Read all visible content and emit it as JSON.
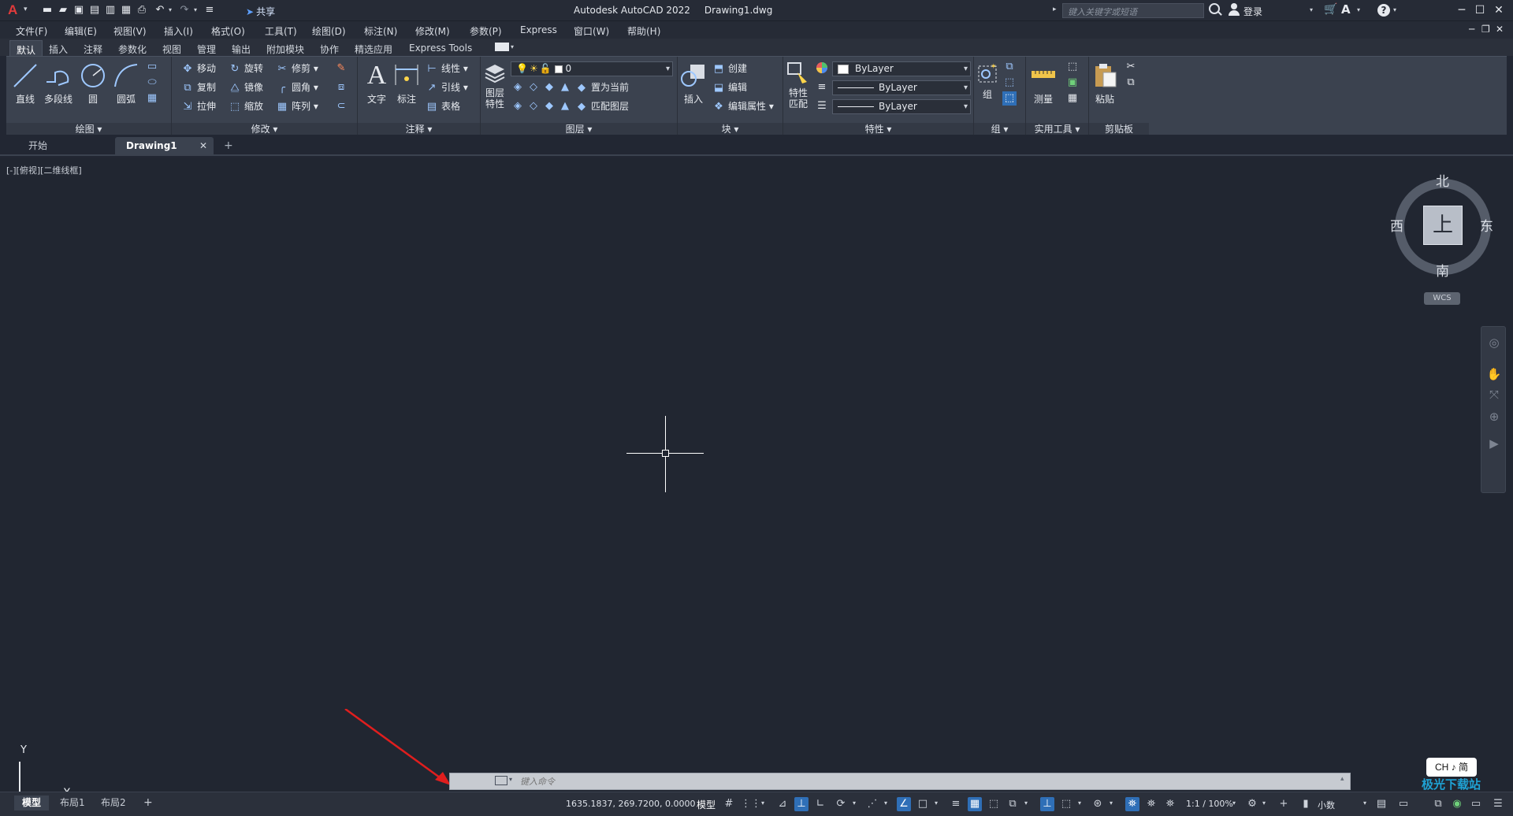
{
  "titlebar": {
    "app_name": "Autodesk AutoCAD 2022",
    "file_name": "Drawing1.dwg",
    "share": "共享",
    "search_placeholder": "键入关键字或短语",
    "login": "登录"
  },
  "menu": [
    "文件(F)",
    "编辑(E)",
    "视图(V)",
    "插入(I)",
    "格式(O)",
    "工具(T)",
    "绘图(D)",
    "标注(N)",
    "修改(M)",
    "参数(P)",
    "Express",
    "窗口(W)",
    "帮助(H)"
  ],
  "ribbon_tabs": [
    "默认",
    "插入",
    "注释",
    "参数化",
    "视图",
    "管理",
    "输出",
    "附加模块",
    "协作",
    "精选应用",
    "Express Tools"
  ],
  "panels": {
    "draw": {
      "title": "绘图",
      "line": "直线",
      "polyline": "多段线",
      "circle": "圆",
      "arc": "圆弧"
    },
    "modify": {
      "title": "修改",
      "move": "移动",
      "rotate": "旋转",
      "trim": "修剪",
      "copy": "复制",
      "mirror": "镜像",
      "fillet": "圆角",
      "stretch": "拉伸",
      "scale": "缩放",
      "array": "阵列"
    },
    "annotation": {
      "title": "注释",
      "text": "文字",
      "dimension": "标注",
      "linear": "线性",
      "leader": "引线",
      "table": "表格"
    },
    "layers": {
      "title": "图层",
      "layer_props": "图层\n特性",
      "layer_current": "0",
      "make_current": "置为当前",
      "match_layer": "匹配图层"
    },
    "block": {
      "title": "块",
      "insert": "插入",
      "create": "创建",
      "edit": "编辑",
      "edit_attr": "编辑属性"
    },
    "properties": {
      "title": "特性",
      "match_props": "特性\n匹配",
      "color": "ByLayer",
      "linetype": "ByLayer",
      "lineweight": "ByLayer"
    },
    "groups": {
      "title": "组",
      "group": "组"
    },
    "utilities": {
      "title": "实用工具",
      "measure": "测量"
    },
    "clipboard": {
      "title": "剪贴板",
      "paste": "粘贴"
    }
  },
  "doc_tabs": {
    "start": "开始",
    "drawing": "Drawing1",
    "close": "✕",
    "new": "+"
  },
  "viewport_label": "[-][俯视][二维线框]",
  "viewcube": {
    "north": "北",
    "south": "南",
    "east": "东",
    "west": "西",
    "face": "上",
    "wcs": "WCS"
  },
  "ucs": {
    "x": "X",
    "y": "Y"
  },
  "command": {
    "placeholder": "键入命令"
  },
  "ime": "CH ♪ 简",
  "layout_tabs": [
    "模型",
    "布局1",
    "布局2",
    "+"
  ],
  "status": {
    "coords": "1635.1837, 269.7200, 0.0000",
    "model": "模型",
    "scale": "1:1 / 100%",
    "units": "小数"
  },
  "watermark": "极光下载站",
  "colors": {
    "accent": "#2f6fb7",
    "arrow": "#e01e1e",
    "canvas": "#212631"
  }
}
